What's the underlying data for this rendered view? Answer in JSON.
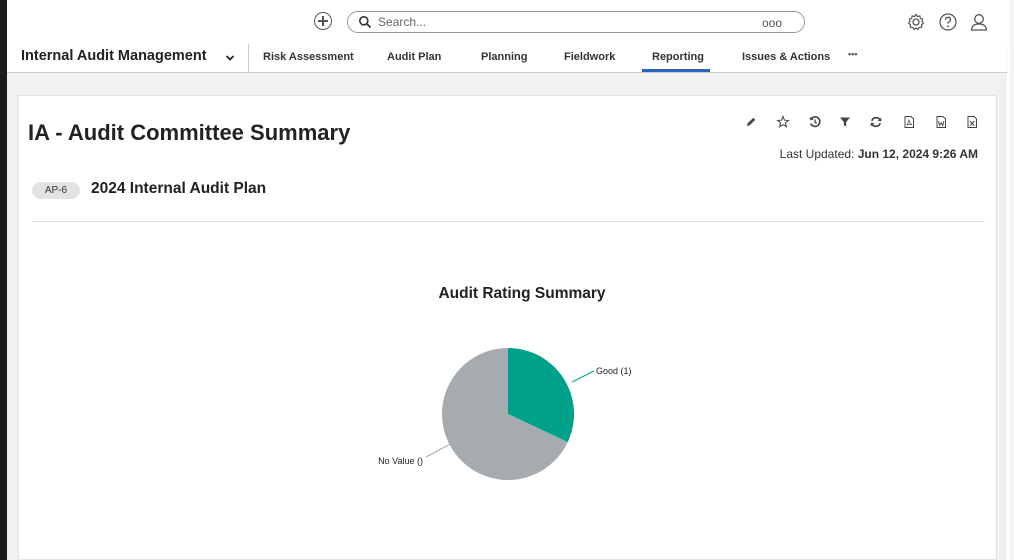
{
  "search": {
    "placeholder": "Search...",
    "options": "ooo"
  },
  "nav": {
    "app_title": "Internal Audit Management",
    "tabs": [
      {
        "label": "Risk Assessment"
      },
      {
        "label": "Audit Plan"
      },
      {
        "label": "Planning"
      },
      {
        "label": "Fieldwork"
      },
      {
        "label": "Reporting"
      },
      {
        "label": "Issues & Actions"
      }
    ],
    "more": "•••",
    "active_tab": "Reporting"
  },
  "report": {
    "title": "IA - Audit Committee Summary",
    "last_updated_label": "Last Updated:",
    "last_updated_value": "Jun 12, 2024 9:26 AM",
    "badge": "AP-6",
    "plan_title": "2024 Internal Audit Plan",
    "toolbar": [
      "pencil-icon",
      "star-icon",
      "history-icon",
      "filter-icon",
      "refresh-icon",
      "pdf-icon",
      "word-icon",
      "excel-icon"
    ]
  },
  "chart_data": {
    "type": "pie",
    "title": "Audit Rating Summary",
    "slices": [
      {
        "label": "Good (1)",
        "fraction": 0.32,
        "color": "#00a18b"
      },
      {
        "label": "No Value ()",
        "fraction": 0.68,
        "color": "#a6abb0"
      }
    ]
  },
  "colors": {
    "accent": "#2a63c3",
    "good": "#00a18b",
    "no_value": "#a6abb0"
  }
}
